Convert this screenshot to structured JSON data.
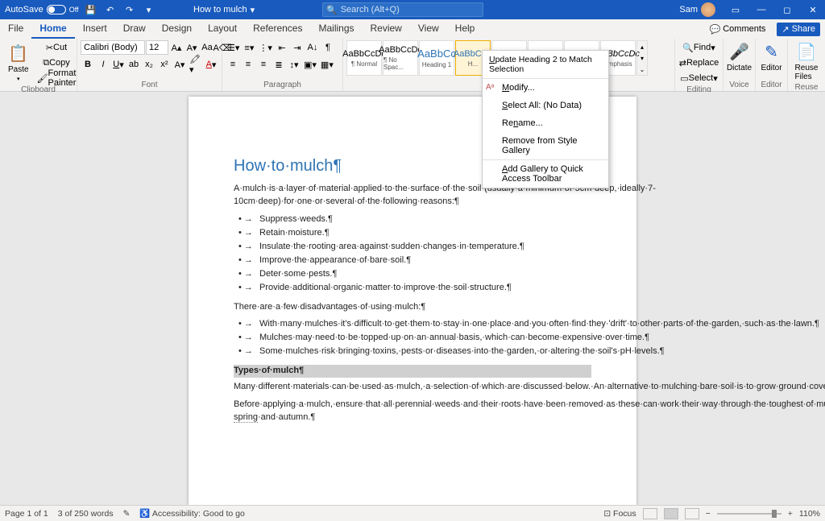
{
  "titlebar": {
    "autosave": "AutoSave",
    "autosave_state": "Off",
    "doc_title": "How to mulch",
    "search_placeholder": "Search (Alt+Q)",
    "user_name": "Sam"
  },
  "tabs": {
    "file": "File",
    "home": "Home",
    "insert": "Insert",
    "draw": "Draw",
    "design": "Design",
    "layout": "Layout",
    "references": "References",
    "mailings": "Mailings",
    "review": "Review",
    "view": "View",
    "help": "Help",
    "comments": "Comments",
    "share": "Share"
  },
  "ribbon": {
    "clipboard": {
      "label": "Clipboard",
      "paste": "Paste",
      "cut": "Cut",
      "copy": "Copy",
      "format_painter": "Format Painter"
    },
    "font": {
      "label": "Font",
      "name": "Calibri (Body)",
      "size": "12"
    },
    "paragraph": {
      "label": "Paragraph"
    },
    "styles": {
      "label": "Styles",
      "items": [
        {
          "preview": "AaBbCcDc",
          "name": "¶ Normal"
        },
        {
          "preview": "AaBbCcDc",
          "name": "¶ No Spac..."
        },
        {
          "preview": "AaBbCc",
          "name": "Heading 1"
        },
        {
          "preview": "AaBbCcD",
          "name": "H..."
        },
        {
          "preview": "AaB",
          "name": ""
        },
        {
          "preview": "AaBbCcD",
          "name": ""
        },
        {
          "preview": "AaBbCcDc",
          "name": ""
        },
        {
          "preview": "AaBbCcDc",
          "name": "Emphasis"
        }
      ]
    },
    "editing": {
      "label": "Editing",
      "find": "Find",
      "replace": "Replace",
      "select": "Select"
    },
    "voice": {
      "label": "Voice",
      "dictate": "Dictate"
    },
    "editor": {
      "label": "Editor",
      "editor": "Editor"
    },
    "reuse": {
      "label": "Reuse Files",
      "reuse": "Reuse Files"
    }
  },
  "context_menu": {
    "top": "Update Heading 2 to Match Selection",
    "modify": "Modify...",
    "select_all": "Select All: (No Data)",
    "rename": "Rename...",
    "remove": "Remove from Style Gallery",
    "add_qat": "Add Gallery to Quick Access Toolbar"
  },
  "document": {
    "title": "How·to·mulch¶",
    "intro": "A·mulch·is·a·layer·of·material·applied·to·the·surface·of·the·soil·(usually·a·minimum·of·5cm·deep,·ideally·7-10cm·deep)·for·one·or·several·of·the·following·reasons:¶",
    "bullets1": [
      "Suppress·weeds.¶",
      "Retain·moisture.¶",
      "Insulate·the·rooting·area·against·sudden·changes·in·temperature.¶",
      "Improve·the·appearance·of·bare·soil.¶",
      "Deter·some·pests.¶",
      "Provide·additional·organic·matter·to·improve·the·soil·structure.¶"
    ],
    "disadv_intro": "There·are·a·few·disadvantages·of·using·mulch:¶",
    "bullets2": [
      "With·many·mulches·it's·difficult·to·get·them·to·stay·in·one·place·and·you·often·find·they·'drift'·to·other·parts·of·the·garden,·such·as·the·lawn.¶",
      "Mulches·may·need·to·be·topped·up·on·an·annual·basis,·which·can·become·expensive·over·time.¶",
      "Some·mulches·risk·bringing·toxins,·pests·or·diseases·into·the·garden,·or·altering·the·soil's·pH·levels.¶"
    ],
    "h2": "Types·of·mulch¶",
    "p1": "Many·different·materials·can·be·used·as·mulch,·a·selection·of·which·are·discussed·below.·An·alternative·to·mulching·bare·soil·is·to·grow·ground·cover·plants,·which·provide·most·of·the·benefits·of·a·mulch·without·some·of·the·disadvantages.¶",
    "p2a": "Before·applying·a·mulch,·ensure·that·all·perennial·weeds·and·their·roots·have·been·removed·as·these·can·work·their·way·through·the·toughest·of·mulches.·Don't·apply·the·mulch·when·the·ground·is·cold·or·frozen·(otherwise·the·mulch·will·keep·the·cold·in·and·prevent·the·soil·warming·up)·and·ensure·the·soil·is·moist·before·applying·it;·it's·best·to·apply·mulch·between·",
    "p2link": "mid-spring",
    "p2b": "·and·autumn.¶"
  },
  "statusbar": {
    "page": "Page 1 of 1",
    "words": "3 of 250 words",
    "accessibility": "Accessibility: Good to go",
    "focus": "Focus",
    "zoom": "110%"
  }
}
